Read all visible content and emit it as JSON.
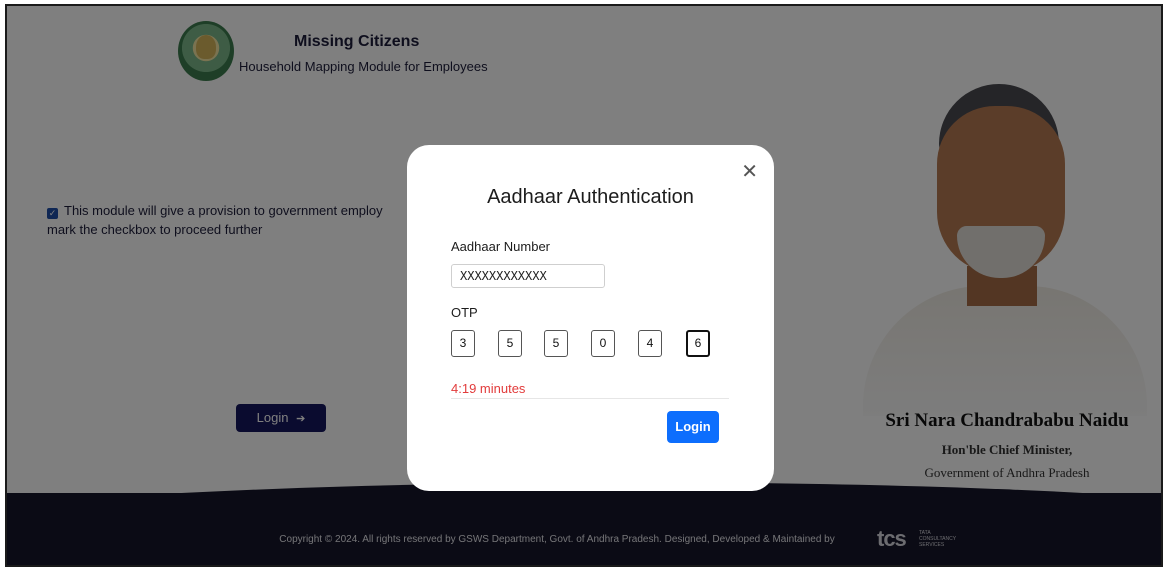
{
  "header": {
    "title": "Missing Citizens",
    "subtitle": "Household Mapping Module for Employees",
    "emblem_icon": "ap-state-emblem-icon"
  },
  "consent": {
    "checked": true,
    "line1": "This module will give a provision to government employ",
    "line2": "mark the checkbox to proceed further"
  },
  "page": {
    "login_label": "Login",
    "login_arrow": "➔"
  },
  "cm": {
    "name": "Sri Nara Chandrababu Naidu",
    "role": "Hon'ble Chief Minister,",
    "government": "Government of Andhra Pradesh"
  },
  "footer": {
    "copyright": "Copyright © 2024. All rights reserved by GSWS Department, Govt. of Andhra Pradesh. Designed, Developed & Maintained by",
    "tcs_logo_text": "tcs",
    "tcs_sub": "TATA CONSULTANCY SERVICES"
  },
  "modal": {
    "title": "Aadhaar Authentication",
    "close_glyph": "✕",
    "aadhaar_label": "Aadhaar Number",
    "aadhaar_value": "XXXXXXXXXXXX",
    "otp_label": "OTP",
    "otp_digits": [
      "3",
      "5",
      "5",
      "0",
      "4",
      "6"
    ],
    "timer": "4:19 minutes",
    "login_label": "Login"
  },
  "colors": {
    "overlay": "#00000080",
    "primary_button": "#0d6efd",
    "page_button": "#15175e",
    "timer_red": "#e23b3b",
    "footer_bg": "#16162a"
  }
}
